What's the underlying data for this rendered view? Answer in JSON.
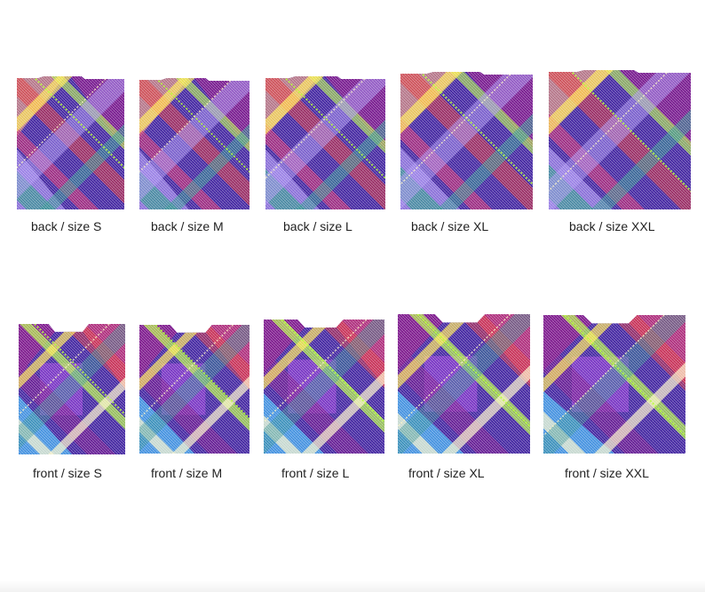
{
  "palette": {
    "base": "#3d1f9e",
    "purple": "#7a138a",
    "magenta": "#c02a72",
    "red": "#e03030",
    "teal": "#2f8f8f",
    "lime": "#b8ff3c",
    "yellow": "#ffe74a",
    "peach": "#f2a07a",
    "lavender": "#a58cf0",
    "sky": "#3f8fdf",
    "cream": "#fff6c8"
  },
  "rows": [
    {
      "side": "back",
      "panels": [
        {
          "size": "S",
          "label": "back / size S"
        },
        {
          "size": "M",
          "label": "back / size M"
        },
        {
          "size": "L",
          "label": "back / size L"
        },
        {
          "size": "XL",
          "label": "back / size XL"
        },
        {
          "size": "XXL",
          "label": "back / size XXL"
        }
      ]
    },
    {
      "side": "front",
      "panels": [
        {
          "size": "S",
          "label": "front / size S"
        },
        {
          "size": "M",
          "label": "front / size M"
        },
        {
          "size": "L",
          "label": "front / size L"
        },
        {
          "size": "XL",
          "label": "front / size XL"
        },
        {
          "size": "XXL",
          "label": "front / size XXL"
        }
      ]
    }
  ]
}
